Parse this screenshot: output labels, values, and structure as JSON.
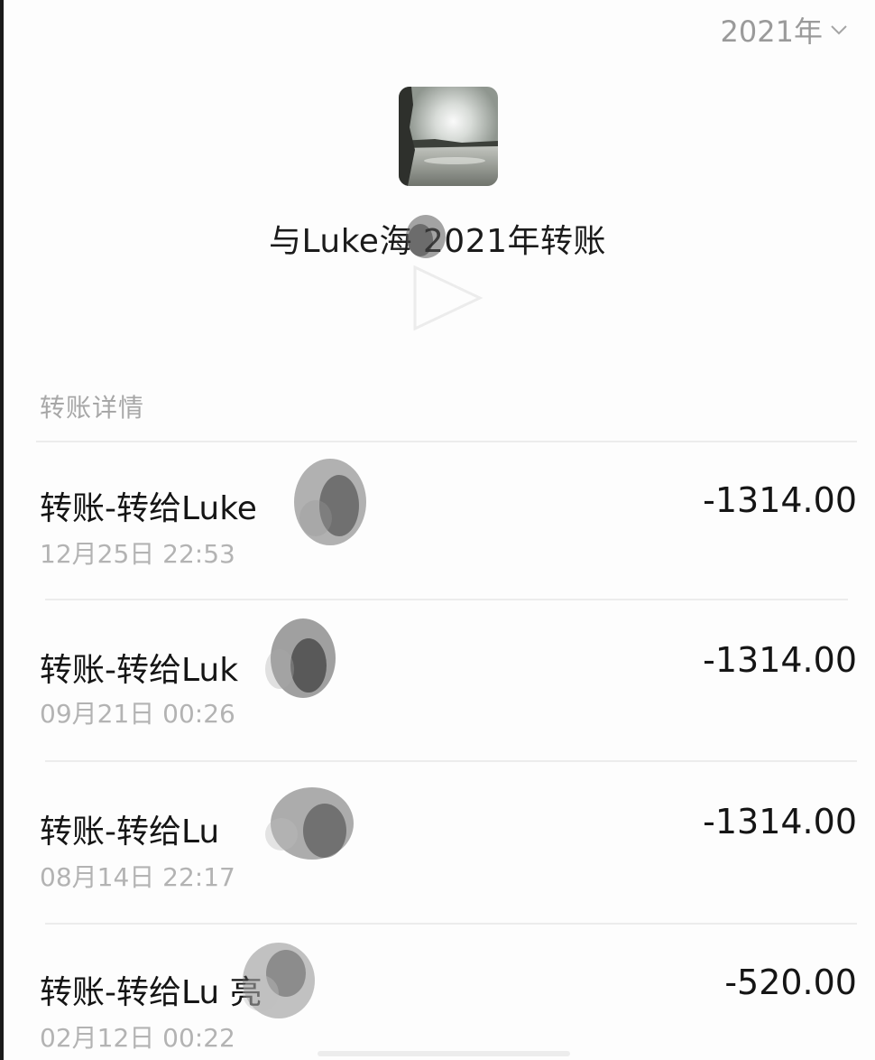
{
  "header": {
    "year_label": "2021年",
    "title": "与Luke海 2021年转账"
  },
  "section": {
    "label": "转账详情"
  },
  "transactions": [
    {
      "title": "转账-转给Luke",
      "time": "12月25日 22:53",
      "amount": "-1314.00"
    },
    {
      "title": "转账-转给Luk",
      "time": "09月21日 00:26",
      "amount": "-1314.00"
    },
    {
      "title": "转账-转给Lu",
      "time": "08月14日 22:17",
      "amount": "-1314.00"
    },
    {
      "title": "转账-转给Lu 亮",
      "time": "02月12日 00:22",
      "amount": "-520.00"
    }
  ],
  "colors": {
    "background": "#fdfdfd",
    "primary_text": "#151515",
    "secondary_text": "#b3b3b3",
    "muted_header": "#9a9a9a",
    "divider": "#ececec"
  },
  "icons": {
    "year_dropdown": "chevron-down-icon",
    "play": "play-icon"
  }
}
